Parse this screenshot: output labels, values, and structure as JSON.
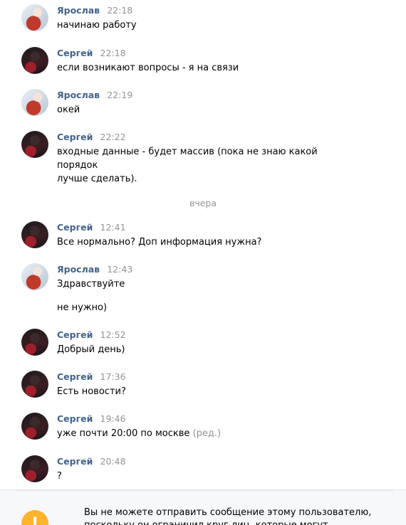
{
  "messages": [
    {
      "author": "Ярослав",
      "time": "22:18",
      "lines": [
        "начинаю работу"
      ]
    },
    {
      "author": "Сергей",
      "time": "22:18",
      "lines": [
        "если возникают вопросы - я на связи"
      ]
    },
    {
      "author": "Ярослав",
      "time": "22:19",
      "lines": [
        "окей"
      ]
    },
    {
      "author": "Сергей",
      "time": "22:22",
      "lines": [
        "входные данные - будет массив (пока не знаю какой порядок",
        "лучше сделать)."
      ]
    },
    {
      "author": "Сергей",
      "time": "12:41",
      "lines": [
        "Все нормально? Доп информация нужна?"
      ]
    },
    {
      "author": "Ярослав",
      "time": "12:43",
      "lines": [
        "Здравствуйте",
        "не нужно)"
      ]
    },
    {
      "author": "Сергей",
      "time": "12:52",
      "lines": [
        "Добрый день)"
      ]
    },
    {
      "author": "Сергей",
      "time": "17:36",
      "lines": [
        "Есть новости?"
      ]
    },
    {
      "author": "Сергей",
      "time": "19:46",
      "lines": [
        "уже почти 20:00 по москве"
      ],
      "edited": "(ред.)"
    },
    {
      "author": "Сергей",
      "time": "20:48",
      "lines": [
        "?"
      ]
    }
  ],
  "divider": "вчера",
  "footer": {
    "icon": "warning-icon",
    "text": "Вы не можете отправить сообщение этому пользователю, поскольку он ограничил круг лиц, которые могут присылать"
  },
  "colors": {
    "author": "#42648b",
    "time": "#939393",
    "warning": "#ffb32b"
  }
}
